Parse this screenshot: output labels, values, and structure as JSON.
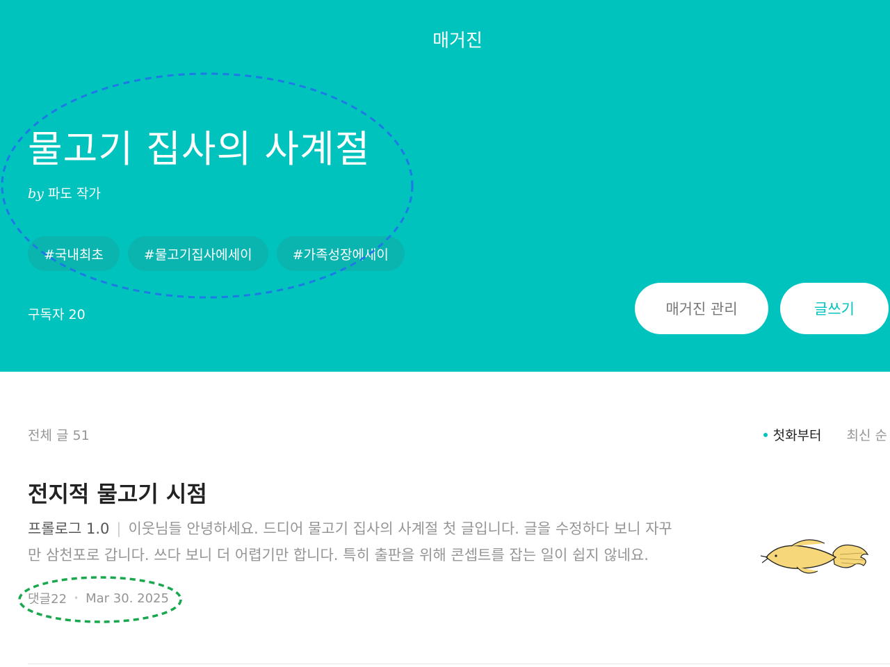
{
  "header": {
    "label": "매거진",
    "title": "물고기 집사의 사계절",
    "byline_prefix": "by",
    "author": "파도 작가",
    "tags": [
      "#국내최초",
      "#물고기집사에세이",
      "#가족성장에세이"
    ],
    "subscribers": "구독자 20",
    "manage_button": "매거진 관리",
    "write_button": "글쓰기"
  },
  "list": {
    "count": "전체 글 51",
    "sort_options": [
      "첫화부터",
      "최신 순"
    ],
    "active_sort": "첫화부터"
  },
  "articles": [
    {
      "title": "전지적 물고기 시점",
      "subtitle": "프롤로그 1.0",
      "excerpt": "이웃님들 안녕하세요. 드디어 물고기 집사의 사계절 첫 글입니다. 글을 수정하다 보니 자꾸만 삼천포로 갑니다. 쓰다 보니 더 어렵기만 합니다. 특히 출판을 위해 콘셉트를 잡는 일이 쉽지 않네요.",
      "comments": "댓글22",
      "date": "Mar 30. 2025",
      "thumbnail_icon": "fish-illustration-icon"
    }
  ],
  "colors": {
    "accent": "#00c3bd",
    "annotation_blue": "#1e78e6",
    "annotation_green": "#1aa84f"
  }
}
